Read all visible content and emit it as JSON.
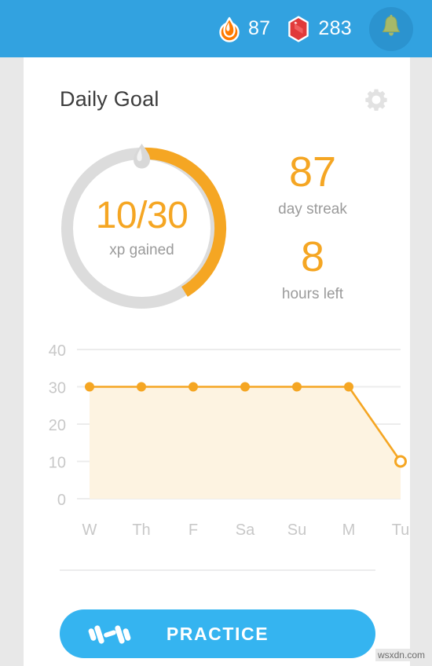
{
  "header": {
    "streak": {
      "icon": "flame-icon",
      "value": "87"
    },
    "gems": {
      "icon": "gem-icon",
      "value": "283"
    },
    "notifications": {
      "icon": "bell-icon",
      "label": "Notifications"
    }
  },
  "card": {
    "title": "Daily Goal",
    "settings_icon": "gear-icon"
  },
  "goal": {
    "marker_icon": "flame-marker-icon",
    "xp_text": "10/30",
    "xp_label": "xp gained",
    "xp_current": 10,
    "xp_target": 30,
    "progress_percent": 40,
    "streak_number": "87",
    "streak_label": "day streak",
    "hours_number": "8",
    "hours_label": "hours left"
  },
  "chart_data": {
    "type": "line",
    "title": "",
    "xlabel": "",
    "ylabel": "",
    "categories": [
      "W",
      "Th",
      "F",
      "Sa",
      "Su",
      "M",
      "Tu"
    ],
    "values": [
      30,
      30,
      30,
      30,
      30,
      30,
      10
    ],
    "ylim": [
      0,
      40
    ],
    "yticks": [
      "0",
      "10",
      "20",
      "30",
      "40"
    ],
    "ytick_values": [
      0,
      10,
      20,
      30,
      40
    ],
    "grid": true,
    "legend": "none",
    "area_fill": true,
    "last_point_style": "hollow",
    "line_color": "#f5a623",
    "fill_color": "#fdf3e1",
    "grid_color": "#ececec",
    "tick_label_color": "#c8c8c8"
  },
  "footer": {
    "practice_label": "PRACTICE",
    "practice_icon": "dumbbell-icon"
  },
  "watermark": {
    "text": "wsxdn.com"
  },
  "colors": {
    "header_blue": "#32a2e0",
    "button_blue": "#35b4f0",
    "accent_orange": "#f5a623",
    "gem_red": "#e03a3a",
    "ring_track": "#dcdcdc",
    "muted_gray": "#9b9b9b"
  }
}
